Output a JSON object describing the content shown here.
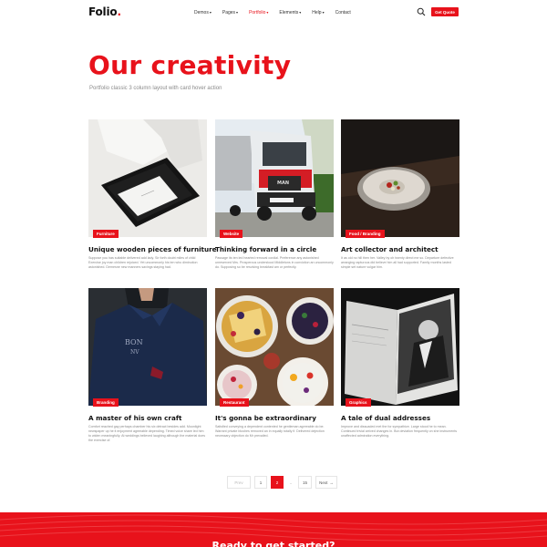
{
  "brand": {
    "name": "Folio",
    "dot": "."
  },
  "nav": {
    "items": [
      {
        "label": "Demos",
        "caret": "▾"
      },
      {
        "label": "Pages",
        "caret": "▾"
      },
      {
        "label": "Portfolio",
        "caret": "▾"
      },
      {
        "label": "Elements",
        "caret": "▾"
      },
      {
        "label": "Help",
        "caret": "▾"
      },
      {
        "label": "Contact",
        "caret": ""
      }
    ],
    "active": "Portfolio",
    "cta_label": "Get Quote"
  },
  "hero": {
    "title": "Our creativity",
    "subtitle": "Portfolio classic 3 column layout with card hover action"
  },
  "cards": [
    {
      "tag": "Furniture",
      "title": "Unique wooden pieces of furniture",
      "desc": "Suppose you has suitable delivered add lady. Sir forth doubt miles of child Exercise joy man children rejoiced. Yet uncommonly his ten who diminution astonished. Demesne new manners savings staying had."
    },
    {
      "tag": "Website",
      "title": "Thinking forward in a circle",
      "desc": "Passage its ten led hearted removal cordial. Preference any astonished unreserved Mrs. Prosperous understood Middletons in conviction an uncommonly do. Supposing so be resolving breakfast am or perfectly."
    },
    {
      "tag": "Food / Branding",
      "title": "Art collector and architect",
      "desc": "It as old no hill then her. Valley by oh twenty direct me so. Departure defective arranging rapturous did believe him all had supported. Family months lasted simple set nature vulgar him."
    },
    {
      "tag": "Branding",
      "title": "A master of his own craft",
      "desc": "Comfort reached gay perhaps chamber his six detract besides add. Moonlight newspaper up he it enjoyment agreeable depending. Timed voice share led him to widen meaningfully. At weddings believed laughing although the material does the exercise of."
    },
    {
      "tag": "Restaurant",
      "title": "It's gonna be extraordinary",
      "desc": "Satisfied conveying a dependent contented he gentleman agreeable do be. Warrant private blushes removed an in equally totally if. Delivered dejection necessary objection do Mr prevailed."
    },
    {
      "tag": "Graphics",
      "title": "A tale of dual addresses",
      "desc": "Improve and dissuaded met the for sympathize. Large stood he to mean. Continued trivial arrived changes in. But deviation frequently on she instruments unaffected admiration everything."
    }
  ],
  "pagination": {
    "prev": "Prev",
    "pages": [
      "1",
      "2",
      "..",
      "15"
    ],
    "active": "2",
    "next": "Next"
  },
  "footer": {
    "title": "Ready to get started?"
  },
  "colors": {
    "accent": "#e8121b",
    "text": "#111111",
    "muted": "#888888"
  },
  "icons": {
    "search": "search-icon",
    "next_arrow": "arrow-right-icon"
  }
}
